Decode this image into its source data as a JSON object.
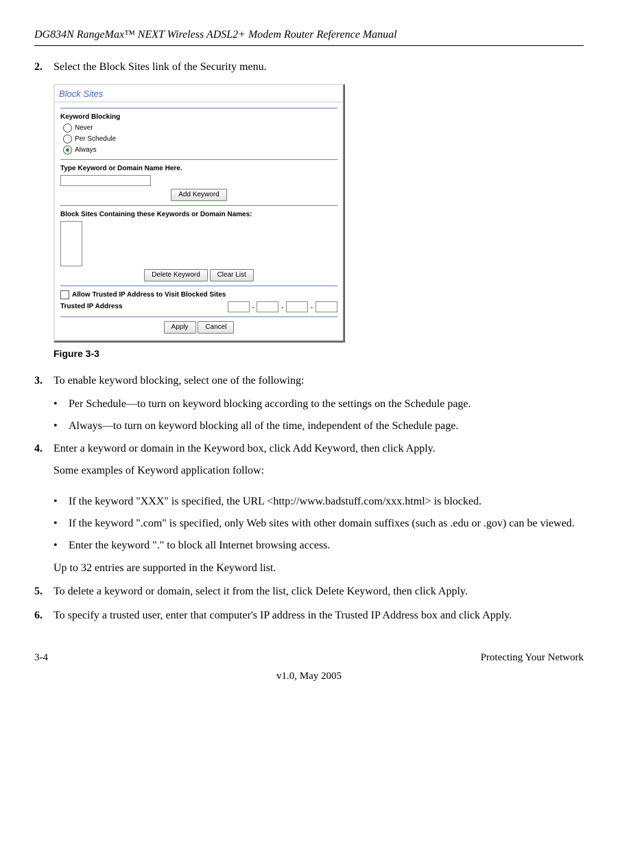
{
  "header": {
    "title": "DG834N RangeMax™ NEXT Wireless ADSL2+ Modem Router Reference Manual"
  },
  "step2": {
    "num": "2.",
    "text": "Select the Block Sites link of the Security menu."
  },
  "figure": {
    "title": "Block Sites",
    "kb_label": "Keyword Blocking",
    "opt_never": "Never",
    "opt_per": "Per Schedule",
    "opt_always": "Always",
    "type_label": "Type Keyword or Domain Name Here.",
    "add_btn": "Add Keyword",
    "contain_label": "Block Sites Containing these Keywords or Domain Names:",
    "del_btn": "Delete Keyword",
    "clear_btn": "Clear List",
    "trusted_check": "Allow Trusted IP Address to Visit Blocked Sites",
    "trusted_label": "Trusted IP Address",
    "apply": "Apply",
    "cancel": "Cancel",
    "caption": "Figure 3-3"
  },
  "step3": {
    "num": "3.",
    "text": "To enable keyword blocking, select one of the following:",
    "b1": "Per Schedule—to turn on keyword blocking according to the settings on the Schedule page.",
    "b2": "Always—to turn on keyword blocking all of the time, independent of the Schedule page."
  },
  "step4": {
    "num": "4.",
    "text": "Enter a keyword or domain in the Keyword box, click Add Keyword, then click Apply.",
    "examples_intro": "Some examples of Keyword application follow:",
    "b1": "If the keyword \"XXX\" is specified, the URL <http://www.badstuff.com/xxx.html> is blocked.",
    "b2": "If the keyword \".com\" is specified, only Web sites with other domain suffixes (such as .edu or .gov) can be viewed.",
    "b3": "Enter the keyword \".\" to block all Internet browsing access.",
    "tail": "Up to 32 entries are supported in the Keyword list."
  },
  "step5": {
    "num": "5.",
    "text": "To delete a keyword or domain, select it from the list, click Delete Keyword, then click Apply."
  },
  "step6": {
    "num": "6.",
    "text": "To specify a trusted user, enter that computer's IP address in the Trusted IP Address box and click Apply."
  },
  "footer": {
    "left": "3-4",
    "right": "Protecting Your Network",
    "center": "v1.0, May 2005"
  }
}
